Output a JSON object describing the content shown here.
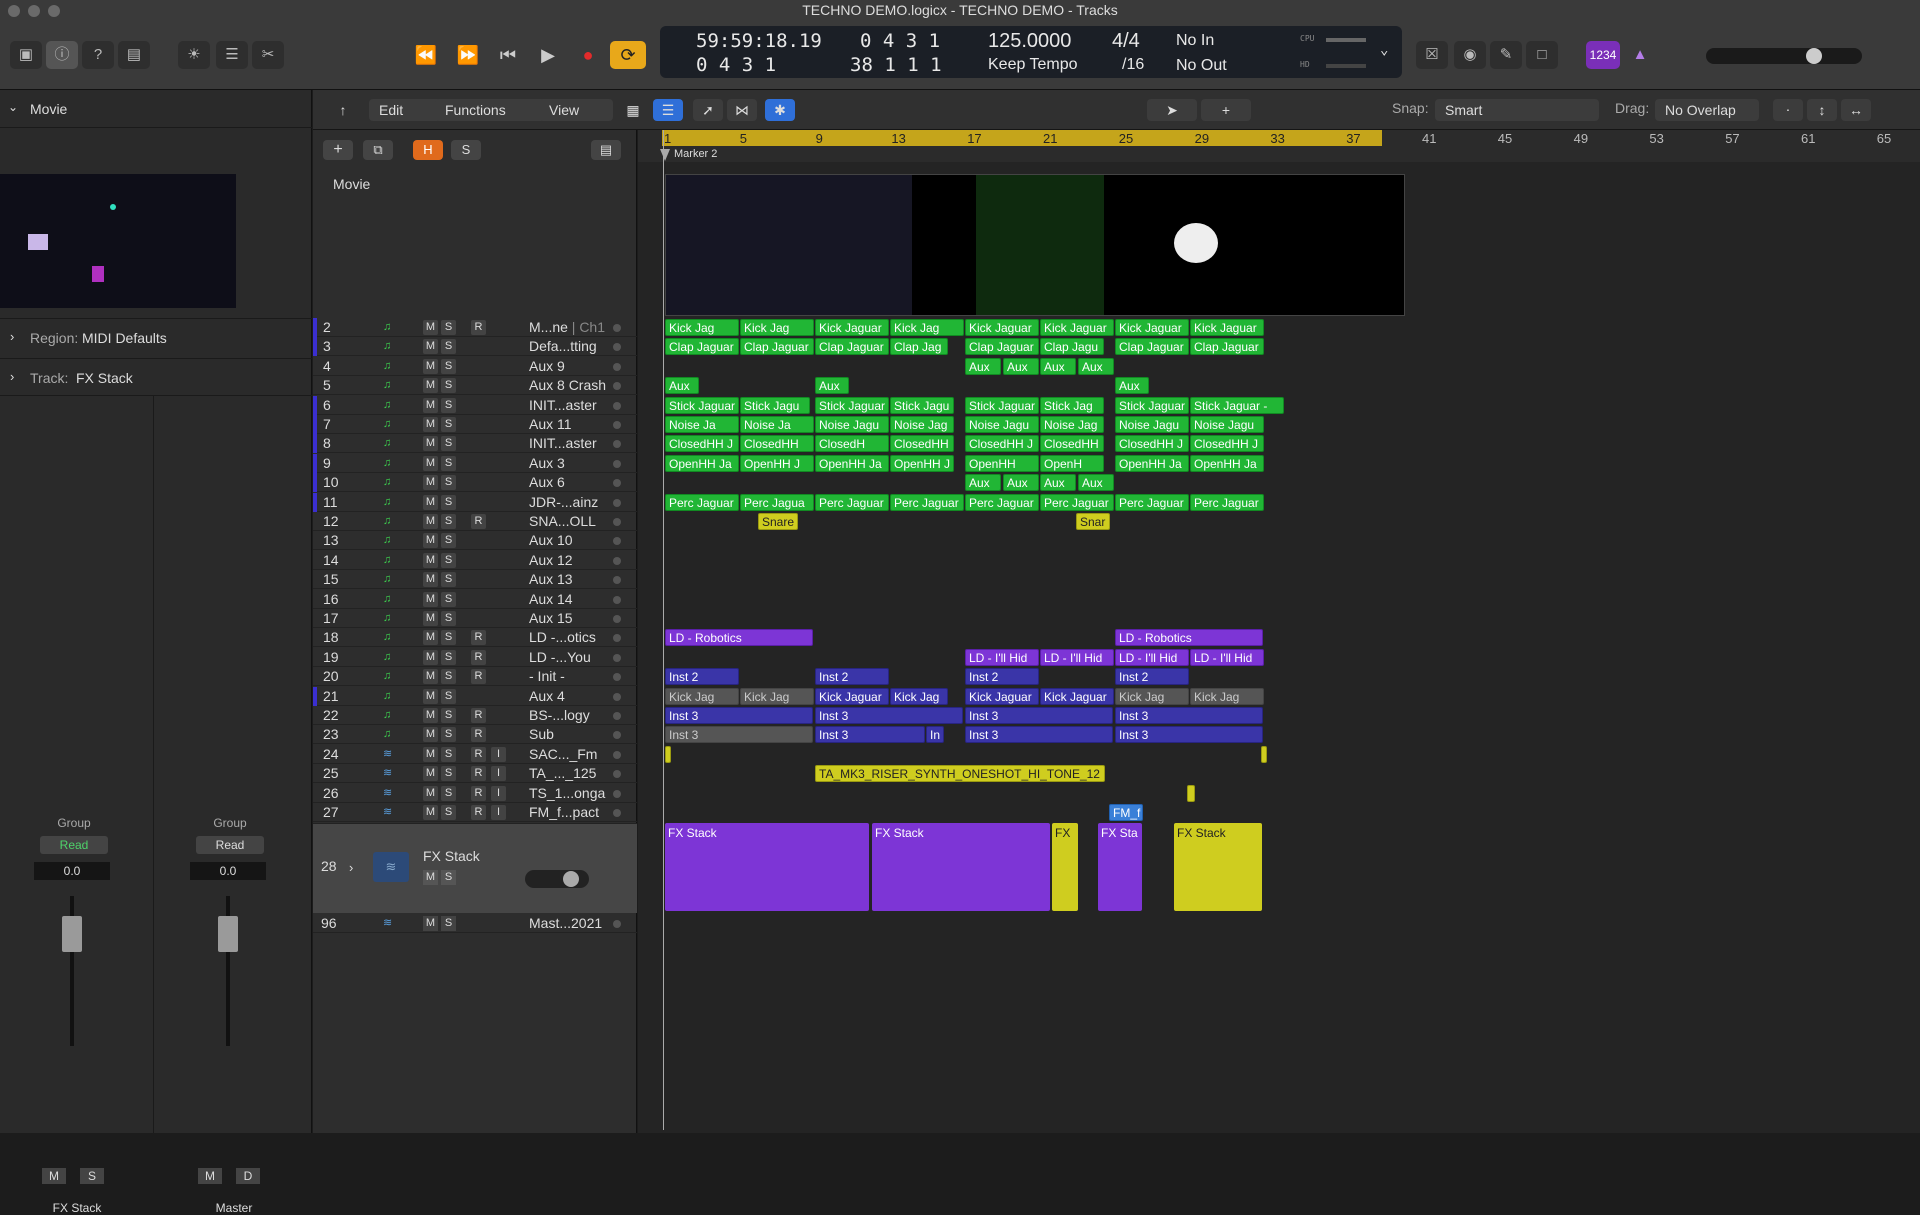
{
  "window": {
    "title": "TECHNO DEMO.logicx - TECHNO DEMO - Tracks"
  },
  "transport": {
    "time": "59:59:18.19",
    "bars": "0 4 3  1",
    "beats": "0 4 3  1",
    "bars2": "38 1 1  1",
    "tempo": "125.0000",
    "tempo_mode": "Keep Tempo",
    "sig": "4/4",
    "div": "/16",
    "in": "No In",
    "out": "No Out",
    "cpu": "CPU",
    "hd": "HD",
    "badge": "1234"
  },
  "inspector": {
    "section": "Movie",
    "region_label": "Region:",
    "region_value": "MIDI Defaults",
    "track_label": "Track:",
    "track_value": "FX Stack",
    "strip1": {
      "group": "Group",
      "mode": "Read",
      "value": "0.0",
      "m": "M",
      "s": "S",
      "name": "FX Stack"
    },
    "strip2": {
      "group": "Group",
      "mode": "Read",
      "value": "0.0",
      "m": "M",
      "s": "D",
      "name": "Master"
    }
  },
  "toolbar": {
    "edit": "Edit",
    "functions": "Functions",
    "view": "View",
    "snap_label": "Snap:",
    "snap_value": "Smart",
    "drag_label": "Drag:",
    "drag_value": "No Overlap",
    "h": "H",
    "s": "S"
  },
  "movie_track": "Movie",
  "ruler": {
    "bars": [
      "1",
      "5",
      "9",
      "13",
      "17",
      "21",
      "25",
      "29",
      "33",
      "37",
      "41",
      "45",
      "49",
      "53",
      "57",
      "61",
      "65"
    ],
    "marker": "Marker 2"
  },
  "tracks": [
    {
      "n": "2",
      "name": "M...ne",
      "sub": "| Ch1",
      "r": true
    },
    {
      "n": "3",
      "name": "Defa...tting"
    },
    {
      "n": "4",
      "name": "Aux 9"
    },
    {
      "n": "5",
      "name": "Aux 8 Crash"
    },
    {
      "n": "6",
      "name": "INIT...aster"
    },
    {
      "n": "7",
      "name": "Aux 11"
    },
    {
      "n": "8",
      "name": "INIT...aster"
    },
    {
      "n": "9",
      "name": "Aux 3"
    },
    {
      "n": "10",
      "name": "Aux 6"
    },
    {
      "n": "11",
      "name": "JDR-...ainz"
    },
    {
      "n": "12",
      "name": "SNA...OLL",
      "r": true
    },
    {
      "n": "13",
      "name": "Aux 10"
    },
    {
      "n": "14",
      "name": "Aux 12"
    },
    {
      "n": "15",
      "name": "Aux 13"
    },
    {
      "n": "16",
      "name": "Aux 14"
    },
    {
      "n": "17",
      "name": "Aux 15"
    },
    {
      "n": "18",
      "name": "LD -...otics",
      "r": true
    },
    {
      "n": "19",
      "name": "LD -...You",
      "r": true
    },
    {
      "n": "20",
      "name": "- Init -",
      "r": true
    },
    {
      "n": "21",
      "name": "Aux 4"
    },
    {
      "n": "22",
      "name": "BS-...logy",
      "r": true
    },
    {
      "n": "23",
      "name": "Sub",
      "r": true
    },
    {
      "n": "24",
      "name": "SAC..._Fm",
      "r": true,
      "i": true
    },
    {
      "n": "25",
      "name": "TA_..._125",
      "r": true,
      "i": true
    },
    {
      "n": "26",
      "name": "TS_1...onga",
      "r": true,
      "i": true
    },
    {
      "n": "27",
      "name": "FM_f...pact",
      "r": true,
      "i": true
    }
  ],
  "track28": {
    "n": "28",
    "name": "FX Stack",
    "m": "M",
    "s": "S"
  },
  "track96": {
    "n": "96",
    "name": "Mast...2021",
    "m": "M",
    "s": "S"
  },
  "regions": {
    "kick": "Kick Jag",
    "kickj": "Kick Jaguar",
    "clap": "Clap Jaguar",
    "clapj": "Clap Jag",
    "clapu": "Clap Jagu",
    "aux": "Aux",
    "stick": "Stick Jaguar",
    "sticku": "Stick Jagu",
    "stickj": "Stick Jag",
    "stickd": "Stick Jaguar -",
    "noise": "Noise Ja",
    "noiseu": "Noise Jagu",
    "noisej": "Noise Jag",
    "closed": "ClosedHH J",
    "closed2": "ClosedHH",
    "closed3": "ClosedH",
    "open": "OpenHH Ja",
    "openj": "OpenHH J",
    "open3": "OpenHH",
    "open4": "OpenH",
    "perc": "Perc Jaguar",
    "percu": "Perc Jagua",
    "snare": "Snare",
    "snar": "Snar",
    "ld": "LD - Robotics",
    "ldh": "LD - I'll Hid",
    "inst2": "Inst 2",
    "inst3": "Inst 3",
    "in": "In",
    "ta": "TA_MK3_RISER_SYNTH_ONESHOT_HI_TONE_12",
    "fm": "FM_f",
    "fx": "FX Stack",
    "fxs": "FX",
    "fxsta": "FX Sta"
  }
}
